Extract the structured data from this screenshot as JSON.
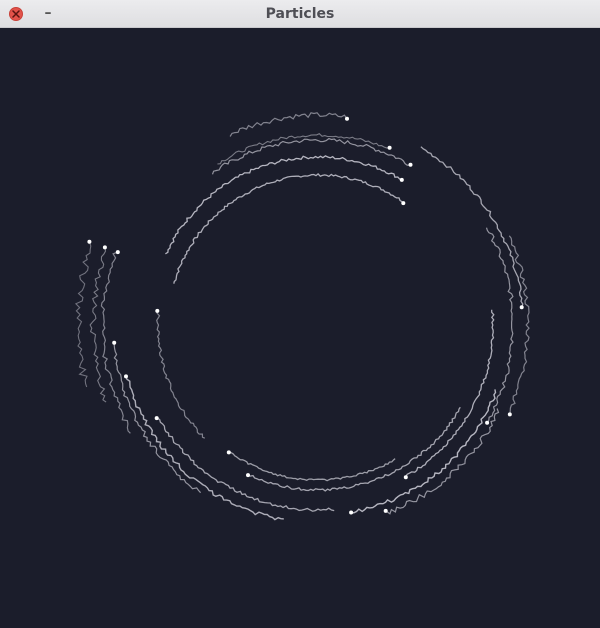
{
  "window": {
    "title": "Particles",
    "minimize_label": "–"
  },
  "icons": {
    "close": "close-icon"
  },
  "colors": {
    "background": "#1b1d2b",
    "titlebar": "#e5e5e8",
    "close_button": "#e2524a",
    "trail": "#c8c8d2",
    "particle_head": "#ffffff"
  }
}
